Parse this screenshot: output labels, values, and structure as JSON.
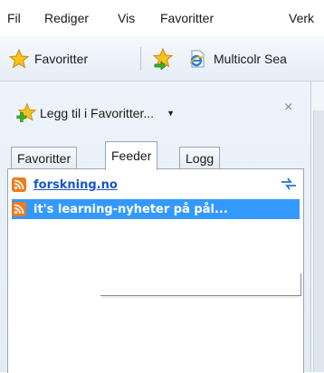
{
  "menubar": {
    "items": [
      "Fil",
      "Rediger",
      "Vis",
      "Favoritter",
      "Verk"
    ]
  },
  "favorites_bar": {
    "favorites_label": "Favoritter",
    "link_label": "Multicolr Sea"
  },
  "panel": {
    "add_label": "Legg til i Favoritter...",
    "close_glyph": "×",
    "tabs": [
      {
        "label": "Favoritter",
        "active": false
      },
      {
        "label": "Feeder",
        "active": true
      },
      {
        "label": "Logg",
        "active": false
      }
    ],
    "feeds": [
      {
        "label": "forskning.no",
        "selected": false
      },
      {
        "label": "it's learning-nyheter på pål...",
        "selected": true
      }
    ]
  },
  "colors": {
    "selection": "#3399ff",
    "link": "#1a55c8",
    "rss": "#f07b1a"
  }
}
